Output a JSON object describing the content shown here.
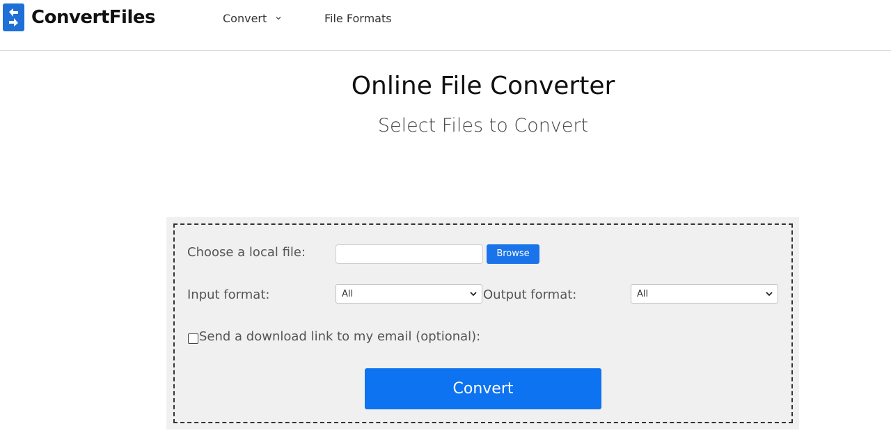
{
  "header": {
    "brand": "ConvertFiles",
    "nav": [
      {
        "label": "Convert",
        "has_dropdown": true
      },
      {
        "label": "File Formats",
        "has_dropdown": false
      }
    ]
  },
  "main": {
    "title": "Online File Converter",
    "subtitle": "Select Files to Convert"
  },
  "form": {
    "file_label": "Choose a local file:",
    "file_value": "",
    "browse_label": "Browse",
    "input_format_label": "Input format:",
    "input_format_value": "All",
    "output_format_label": "Output format:",
    "output_format_value": "All",
    "email_label": "Send a download link to my email (optional):",
    "email_checked": false,
    "convert_label": "Convert"
  },
  "colors": {
    "accent": "#0d73f0",
    "brand": "#1e6fd6"
  },
  "icons": [
    "logo-icon",
    "chevron-down-icon"
  ]
}
